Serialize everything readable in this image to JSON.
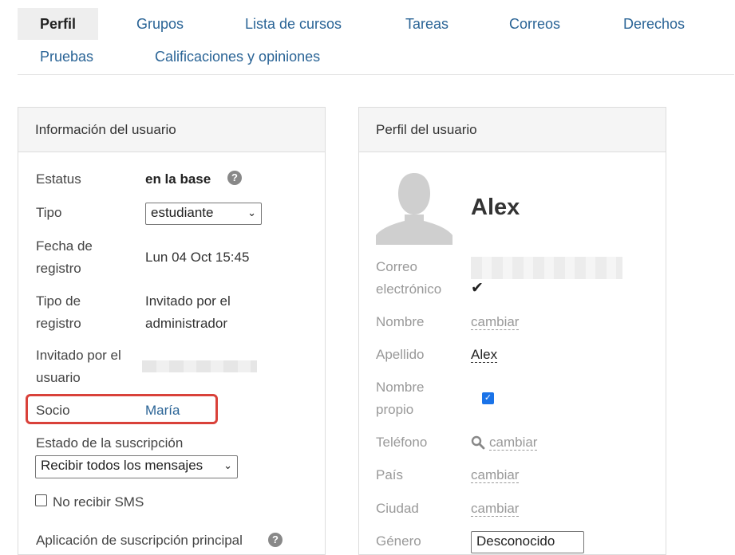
{
  "tabs": [
    {
      "label": "Perfil"
    },
    {
      "label": "Grupos"
    },
    {
      "label": "Lista de cursos"
    },
    {
      "label": "Tareas"
    },
    {
      "label": "Correos"
    },
    {
      "label": "Derechos"
    },
    {
      "label": "Pruebas"
    },
    {
      "label": "Calificaciones y opiniones"
    }
  ],
  "user_info": {
    "title": "Información del usuario",
    "status_label": "Estatus",
    "status_value": "en la base",
    "type_label": "Tipo",
    "type_value": "estudiante",
    "reg_date_label_1": "Fecha de",
    "reg_date_label_2": "registro",
    "reg_date_value": "Lun 04 Oct 15:45",
    "reg_type_label_1": "Tipo de",
    "reg_type_label_2": "registro",
    "reg_type_value_1": "Invitado por el",
    "reg_type_value_2": "administrador",
    "invited_label_1": "Invitado por el",
    "invited_label_2": "usuario",
    "partner_label": "Socio",
    "partner_value": "María",
    "subscription_label": "Estado de la suscripción",
    "subscription_value": "Recibir todos los mensajes",
    "no_sms_label": "No recibir SMS",
    "app_label": "Aplicación de suscripción principal"
  },
  "user_profile": {
    "title": "Perfil del usuario",
    "name": "Alex",
    "email_label_1": "Correo",
    "email_label_2": "electrónico",
    "first_name_label": "Nombre",
    "first_name_action": "cambiar",
    "last_name_label": "Apellido",
    "last_name_value": "Alex",
    "own_name_label_1": "Nombre",
    "own_name_label_2": "propio",
    "phone_label": "Teléfono",
    "phone_action": "cambiar",
    "country_label": "País",
    "country_action": "cambiar",
    "city_label": "Ciudad",
    "city_action": "cambiar",
    "gender_label": "Género",
    "gender_value": "Desconocido"
  },
  "icons": {
    "help": "question-circle-icon",
    "chevron": "chevron-down-icon",
    "check": "checkmark-icon",
    "search": "search-icon",
    "avatar": "user-silhouette-icon"
  },
  "colors": {
    "link": "#2a6496",
    "highlight": "#d9413a",
    "checkbox": "#1a73e8"
  }
}
